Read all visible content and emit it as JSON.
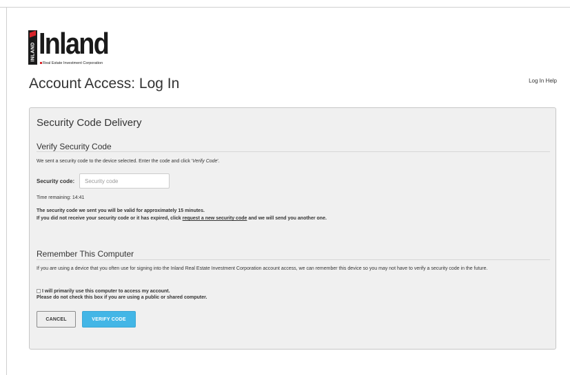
{
  "logo": {
    "vertical_text": "INLAND",
    "word": "Inland",
    "subtitle": "Real Estate Investment Corporation"
  },
  "header": {
    "title": "Account Access: Log In",
    "help_link": "Log In Help"
  },
  "panel": {
    "title": "Security Code Delivery",
    "verify": {
      "heading": "Verify Security Code",
      "intro_prefix": "We sent a security code to the device selected. Enter the code and click '",
      "intro_em": "Verify Code",
      "intro_suffix": "'.",
      "field_label": "Security code:",
      "field_placeholder": "Security code",
      "field_value": "",
      "time_remaining": "Time remaining: 14:41",
      "validity_note": "The security code we sent you will be valid for approximately 15 minutes.",
      "resend_prefix": "If you did not receive your security code or it has expired, click ",
      "resend_link": "request a new security code",
      "resend_suffix": " and we will send you another one."
    },
    "remember": {
      "heading": "Remember This Computer",
      "description": "If you are using a device that you often use for signing into the Inland Real Estate Investment Corporation account access, we can remember this device so you may not have to verify a security code in the future.",
      "checkbox_label": "I will primarily use this computer to access my account.",
      "checkbox_checked": false,
      "warning": "Please do not check this box if you are using a public or shared computer."
    },
    "buttons": {
      "cancel": "CANCEL",
      "verify": "VERIFY CODE"
    }
  },
  "colors": {
    "accent": "#43b6e6",
    "logo_red": "#d8252b",
    "panel_bg": "#f0f0f0"
  }
}
